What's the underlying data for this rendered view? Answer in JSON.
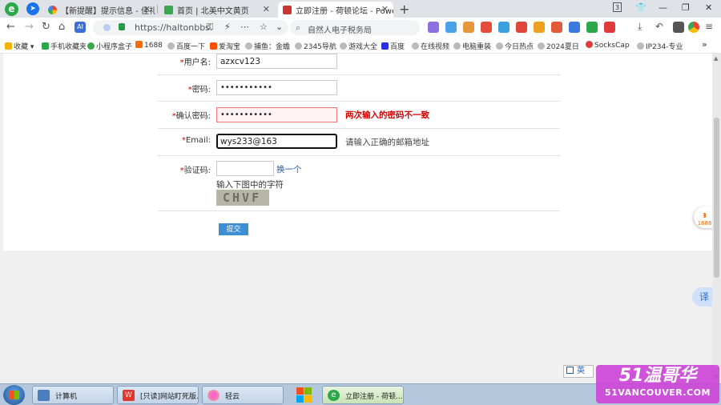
{
  "browser": {
    "tabs": [
      {
        "title": "【新提醒】提示信息 - 佳礼资",
        "active": false
      },
      {
        "title": "首页 | 北美中文黄页",
        "active": false
      },
      {
        "title": "立即注册 - 荷顿论坛 - Power",
        "active": true
      }
    ],
    "new_tab_label": "+",
    "tab_count": "3",
    "address_url": "https://haltonbbs.",
    "search_placeholder": "自然人电子税务局"
  },
  "bookmarks": [
    "收藏",
    "手机收藏夹",
    "小程序盒子",
    "1688",
    "百度一下",
    "爱淘宝",
    "捕鱼：金蟾",
    "2345导航",
    "游戏大全",
    "百度",
    "在线视频",
    "电脑重装",
    "今日热点",
    "2024夏日",
    "SocksCap",
    "IP234-专业"
  ],
  "form": {
    "username": {
      "label": "用户名:",
      "value": "azxcv123"
    },
    "password": {
      "label": "密码:",
      "value": "•••••••••••"
    },
    "confirm_password": {
      "label": "确认密码:",
      "value": "•••••••••••",
      "error": "两次输入的密码不一致"
    },
    "email": {
      "label": "Email:",
      "value": "wys233@163",
      "hint": "请输入正确的邮箱地址"
    },
    "captcha": {
      "label": "验证码:",
      "value": "",
      "refresh_label": "换一个",
      "hint": "输入下图中的字符",
      "image_text": "CHVF"
    },
    "required_mark": "*",
    "submit_label": "提交"
  },
  "widgets": {
    "badge_1688": "1688",
    "translate_label": "译",
    "ime_label": "英"
  },
  "taskbar": {
    "items": [
      {
        "label": "计算机",
        "active": false
      },
      {
        "label": "[只读]网站盯死版...",
        "active": false
      },
      {
        "label": "轻云",
        "active": false
      },
      {
        "label": "立即注册 - 荷顿...",
        "active": true
      }
    ]
  },
  "watermark": {
    "line1": "51温哥华",
    "line2": "51VANCOUVER.COM"
  },
  "colors": {
    "error": "#d40000",
    "link": "#1a5aa8",
    "submit_bg": "#3e8ed4",
    "error_field_bg": "#fff2f2"
  }
}
